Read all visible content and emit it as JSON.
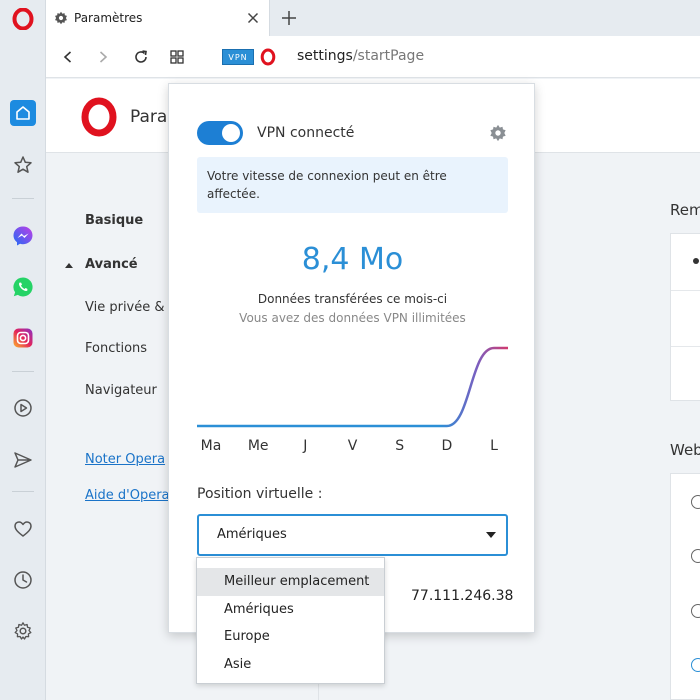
{
  "tab": {
    "title": "Paramètres"
  },
  "address": {
    "host": "settings",
    "path": "/startPage",
    "vpn_badge": "VPN"
  },
  "settings": {
    "title": "Para",
    "nav": [
      {
        "label": "Basique"
      },
      {
        "label": "Avancé"
      },
      {
        "label": "Vie privée &"
      },
      {
        "label": "Fonctions"
      },
      {
        "label": "Navigateur"
      }
    ],
    "links": [
      "Noter Opera",
      "Aide d'Opera"
    ],
    "section_right_1": "Rem",
    "section_right_2": "Web"
  },
  "vpn": {
    "status": "VPN connecté",
    "enabled": true,
    "info": "Votre vitesse de connexion peut en être affectée.",
    "amount": "8,4 Mo",
    "transferred_label": "Données transférées ce mois-ci",
    "unlimited_label": "Vous avez des données VPN illimitées",
    "position_label": "Position virtuelle :",
    "selected_location": "Amériques",
    "ip": "77.111.246.38",
    "locations": [
      "Meilleur emplacement",
      "Amériques",
      "Europe",
      "Asie"
    ],
    "highlighted_location": "Meilleur emplacement",
    "accent_color": "#2b8fd6"
  },
  "chart_data": {
    "type": "line",
    "categories": [
      "Ma",
      "Me",
      "J",
      "V",
      "S",
      "D",
      "L"
    ],
    "values": [
      0,
      0,
      0,
      0,
      0,
      0,
      8.4
    ],
    "unit": "Mo"
  }
}
